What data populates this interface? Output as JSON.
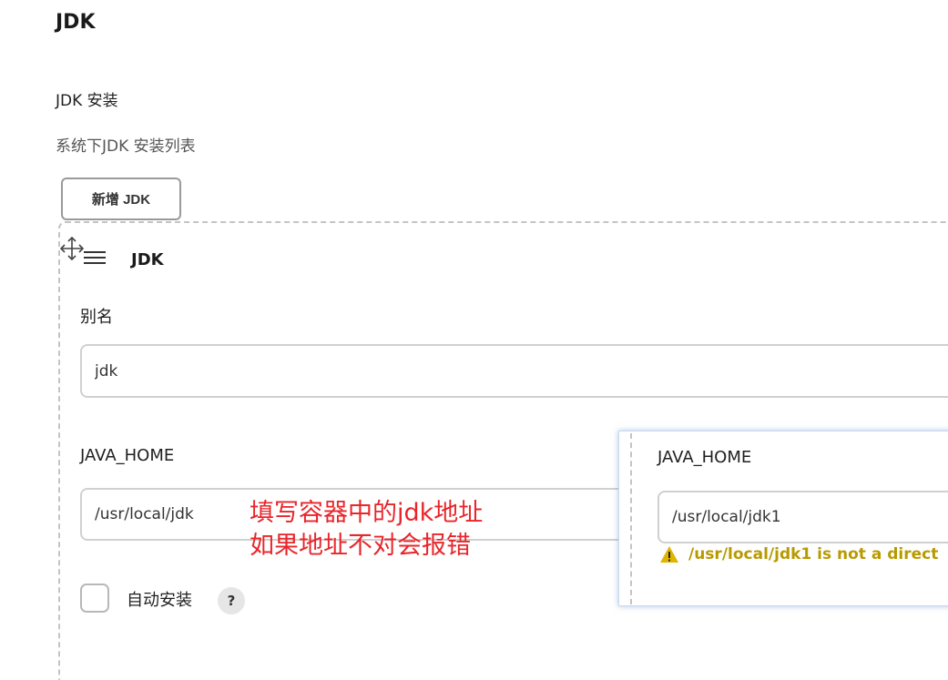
{
  "section": {
    "title": "JDK"
  },
  "field": {
    "title": "JDK 安装",
    "description": "系统下JDK 安装列表"
  },
  "add_button": {
    "label": "新增 JDK"
  },
  "item": {
    "heading": "JDK",
    "alias_label": "别名",
    "alias_value": "jdk",
    "java_home_label": "JAVA_HOME",
    "java_home_value": "/usr/local/jdk",
    "auto_install_label": "自动安装",
    "help_label": "?",
    "auto_install_checked": false
  },
  "annotation": {
    "line1": "填写容器中的jdk地址",
    "line2": "如果地址不对会报错"
  },
  "overlay": {
    "java_home_label": "JAVA_HOME",
    "java_home_value": "/usr/local/jdk1",
    "warning_text": "/usr/local/jdk1 is not a direct"
  },
  "colors": {
    "annotation": "#e8262b",
    "warning": "#b89a00"
  },
  "icons": {
    "move": "move-cursor-icon",
    "drag": "drag-handle-icon",
    "help": "help-icon",
    "warning": "warning-triangle-icon"
  }
}
